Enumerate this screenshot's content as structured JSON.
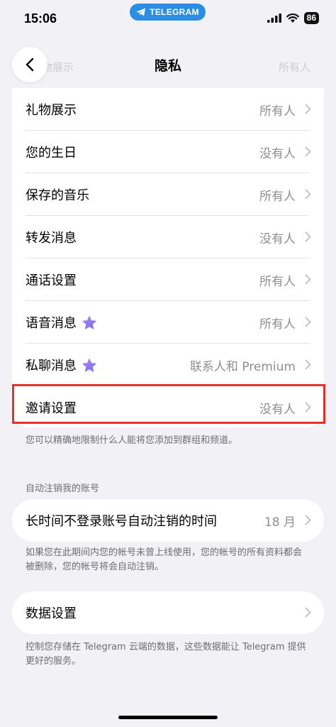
{
  "status_bar": {
    "time": "15:06",
    "app_pill": "TELEGRAM",
    "battery": "86"
  },
  "nav": {
    "title": "隐私",
    "ghost_label": "礼物展示",
    "ghost_value": "所有人"
  },
  "privacy_items": [
    {
      "label": "礼物展示",
      "value": "所有人",
      "premium": false
    },
    {
      "label": "您的生日",
      "value": "没有人",
      "premium": false
    },
    {
      "label": "保存的音乐",
      "value": "所有人",
      "premium": false
    },
    {
      "label": "转发消息",
      "value": "没有人",
      "premium": false
    },
    {
      "label": "通话设置",
      "value": "所有人",
      "premium": false
    },
    {
      "label": "语音消息",
      "value": "所有人",
      "premium": true
    },
    {
      "label": "私聊消息",
      "value": "联系人和 Premium",
      "premium": true
    },
    {
      "label": "邀请设置",
      "value": "没有人",
      "premium": false
    }
  ],
  "invite_footnote": "您可以精确地限制什么人能将您添加到群组和频道。",
  "auto_delete": {
    "header": "自动注销我的账号",
    "label": "长时间不登录账号自动注销的时间",
    "value": "18 月",
    "footnote": "如果您在此期间内您的帐号未曾上线使用，您的帐号的所有资料都会被删除，您的帐号将会自动注销。"
  },
  "data_settings": {
    "label": "数据设置",
    "footnote": "控制您存储在 Telegram 云端的数据，这些数据能让 Telegram 提供更好的服务。"
  },
  "colors": {
    "highlight": "#e8302a",
    "premium_star": "#8e6cf0",
    "pill": "#2a8de6"
  }
}
